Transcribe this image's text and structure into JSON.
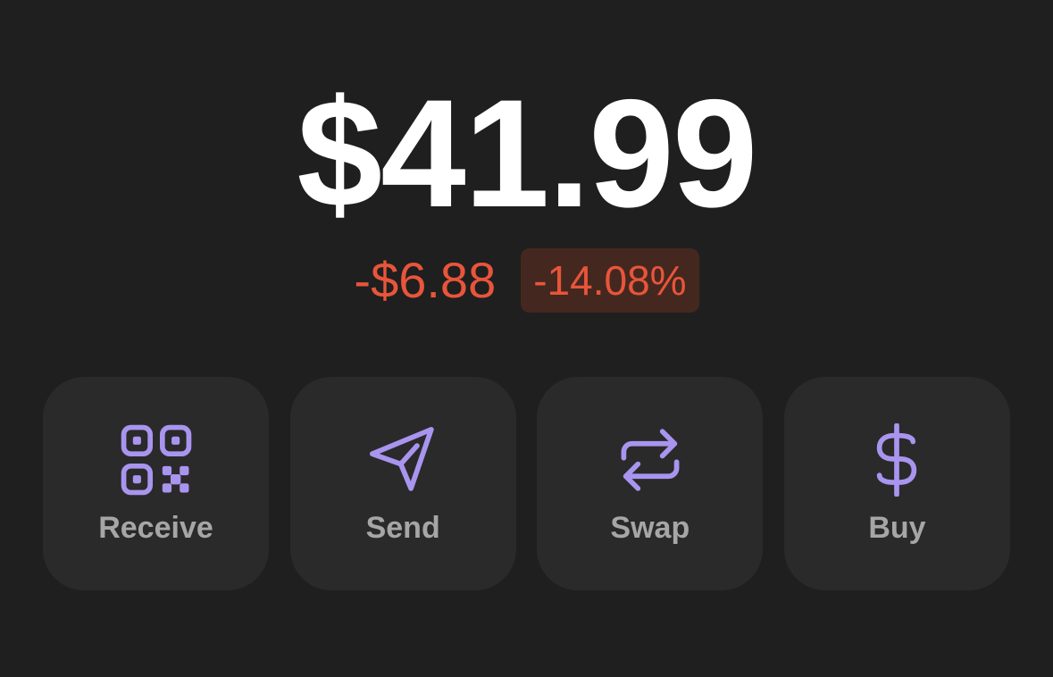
{
  "balance": {
    "value": "$41.99"
  },
  "change": {
    "amount": "-$6.88",
    "percent": "-14.08%",
    "color": "#e8553b"
  },
  "actions": [
    {
      "label": "Receive",
      "icon": "qr-code-icon"
    },
    {
      "label": "Send",
      "icon": "paper-plane-icon"
    },
    {
      "label": "Swap",
      "icon": "swap-arrows-icon"
    },
    {
      "label": "Buy",
      "icon": "dollar-icon"
    }
  ],
  "colors": {
    "background": "#1f1f1f",
    "card": "#2a2a2a",
    "accent": "#a995ef",
    "negative": "#e8553b",
    "negative_bg": "#44281f"
  }
}
